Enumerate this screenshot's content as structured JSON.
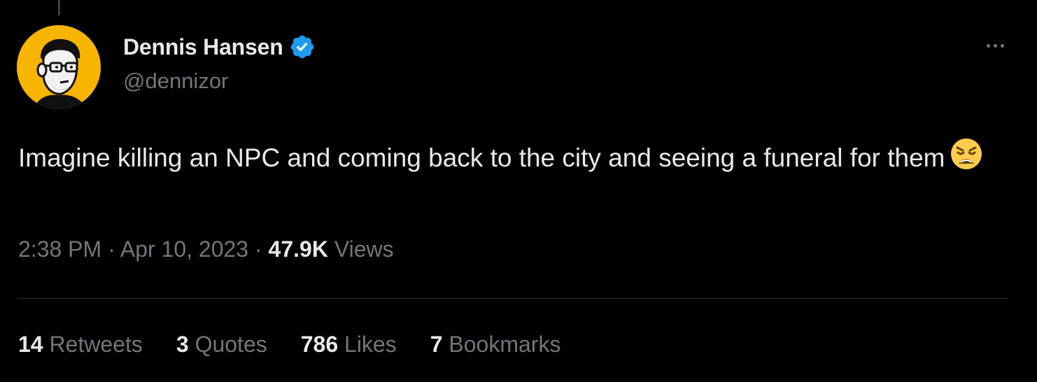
{
  "author": {
    "display_name": "Dennis Hansen",
    "handle": "@dennizor",
    "verified": true,
    "avatar_bg_color": "#f7b500"
  },
  "tweet": {
    "text": "Imagine killing an NPC and coming back to the city and seeing a funeral for them",
    "emoji": "weary-face-emoji"
  },
  "meta": {
    "time": "2:38 PM",
    "separator": " · ",
    "date": "Apr 10, 2023",
    "views_count": "47.9K",
    "views_label": "Views"
  },
  "stats": [
    {
      "count": "14",
      "label": "Retweets"
    },
    {
      "count": "3",
      "label": "Quotes"
    },
    {
      "count": "786",
      "label": "Likes"
    },
    {
      "count": "7",
      "label": "Bookmarks"
    }
  ],
  "colors": {
    "background": "#000000",
    "text_primary": "#e7e9ea",
    "text_secondary": "#71767b",
    "verified_blue": "#1d9bf0",
    "divider": "#2f3336"
  }
}
